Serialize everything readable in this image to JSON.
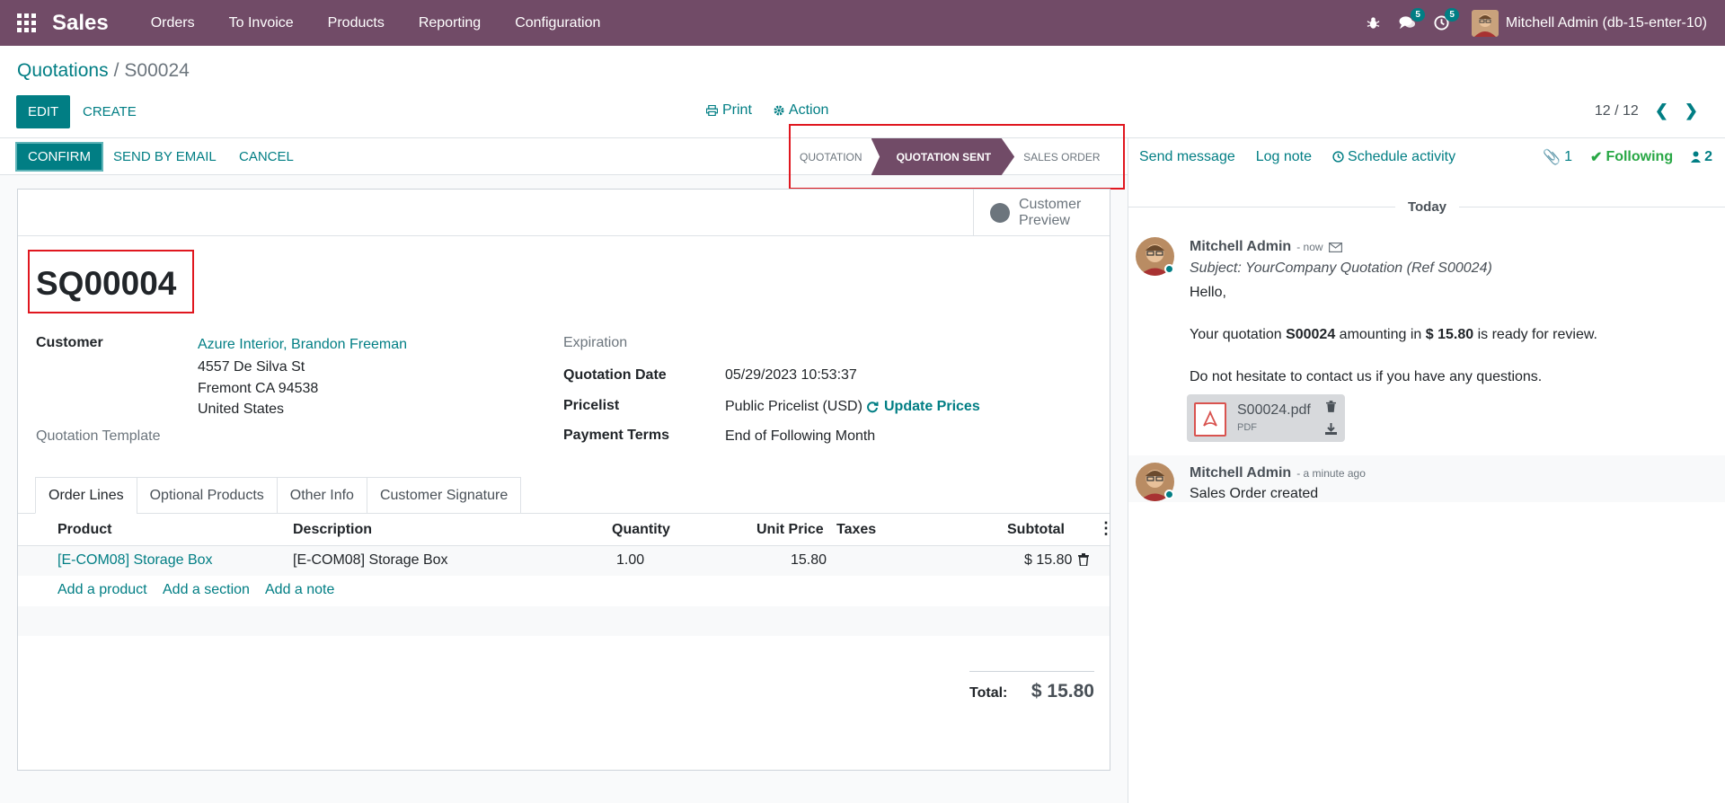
{
  "navbar": {
    "app_name": "Sales",
    "menu": [
      "Orders",
      "To Invoice",
      "Products",
      "Reporting",
      "Configuration"
    ],
    "messages_badge": "5",
    "activities_badge": "5",
    "user": "Mitchell Admin (db-15-enter-10)"
  },
  "breadcrumb": {
    "parent": "Quotations",
    "separator": "/",
    "current": "S00024"
  },
  "control": {
    "edit_label": "EDIT",
    "create_label": "CREATE",
    "print_label": "Print",
    "action_label": "Action",
    "pager": "12 / 12"
  },
  "statusbar": {
    "confirm_label": "CONFIRM",
    "send_email_label": "SEND BY EMAIL",
    "cancel_label": "CANCEL",
    "stages": [
      "QUOTATION",
      "QUOTATION SENT",
      "SALES ORDER"
    ],
    "active_stage": "QUOTATION SENT"
  },
  "sheet": {
    "preview_label_1": "Customer",
    "preview_label_2": "Preview",
    "title": "SQ00004",
    "customer_label": "Customer",
    "customer_name": "Azure Interior, Brandon Freeman",
    "address_1": "4557 De Silva St",
    "address_2": "Fremont CA 94538",
    "address_3": "United States",
    "template_label": "Quotation Template",
    "expiration_label": "Expiration",
    "quote_date_label": "Quotation Date",
    "quote_date": "05/29/2023 10:53:37",
    "pricelist_label": "Pricelist",
    "pricelist": "Public Pricelist (USD)",
    "update_prices": "Update Prices",
    "payment_terms_label": "Payment Terms",
    "payment_terms": "End of Following Month"
  },
  "tabs": [
    "Order Lines",
    "Optional Products",
    "Other Info",
    "Customer Signature"
  ],
  "order_lines": {
    "headers": {
      "product": "Product",
      "description": "Description",
      "quantity": "Quantity",
      "unit_price": "Unit Price",
      "taxes": "Taxes",
      "subtotal": "Subtotal"
    },
    "rows": [
      {
        "product": "[E-COM08] Storage Box",
        "description": "[E-COM08] Storage Box",
        "quantity": "1.00",
        "unit_price": "15.80",
        "taxes": "",
        "subtotal": "$ 15.80"
      }
    ],
    "add_product": "Add a product",
    "add_section": "Add a section",
    "add_note": "Add a note"
  },
  "totals": {
    "label": "Total:",
    "value": "$ 15.80"
  },
  "chatter": {
    "send_message": "Send message",
    "log_note": "Log note",
    "schedule_activity": "Schedule activity",
    "attachments_count": "1",
    "following": "Following",
    "followers_count": "2",
    "day": "Today",
    "messages": [
      {
        "author": "Mitchell Admin",
        "when": "- now",
        "subject": "Subject: YourCompany Quotation (Ref S00024)",
        "greeting": "Hello,",
        "body_pre": "Your quotation ",
        "body_ref": "S00024",
        "body_mid": " amounting in ",
        "body_amount": "$ 15.80",
        "body_post": " is ready for review.",
        "closing": "Do not hesitate to contact us if you have any questions.",
        "attachment_name": "S00024.pdf",
        "attachment_type": "PDF"
      },
      {
        "author": "Mitchell Admin",
        "when": "- a minute ago",
        "body": "Sales Order created"
      }
    ]
  },
  "colors": {
    "brand": "#714b67",
    "accent": "#017e84",
    "highlight_box": "#e0171f",
    "following": "#28a745"
  }
}
